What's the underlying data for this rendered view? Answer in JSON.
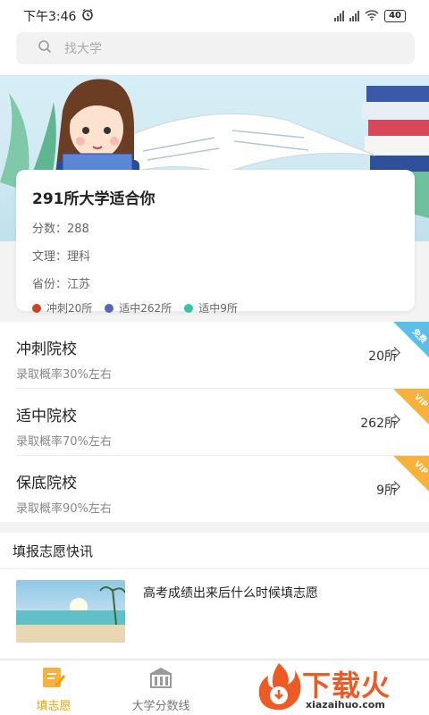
{
  "status_bar": {
    "time": "下午3:46",
    "battery": "40"
  },
  "search": {
    "placeholder": "找大学"
  },
  "result": {
    "title": "291所大学适合你",
    "score": "分数：288",
    "subject": "文理：理科",
    "province": "省份：江苏",
    "legend": [
      {
        "label": "冲刺20所",
        "color": "#c9432a"
      },
      {
        "label": "适中262所",
        "color": "#5b65b5"
      },
      {
        "label": "适中9所",
        "color": "#37c3a8"
      }
    ]
  },
  "categories": [
    {
      "name": "冲刺院校",
      "probability": "录取概率30%左右",
      "count": "20所",
      "badge": "免费",
      "badge_color": "#5bc0e8"
    },
    {
      "name": "适中院校",
      "probability": "录取概率70%左右",
      "count": "262所",
      "badge": "VIP",
      "badge_color": "#f6b23a"
    },
    {
      "name": "保底院校",
      "probability": "录取概率90%左右",
      "count": "9所",
      "badge": "VIP",
      "badge_color": "#f6b23a"
    }
  ],
  "news": {
    "heading": "填报志愿快讯",
    "items": [
      {
        "title": "高考成绩出来后什么时候填志愿"
      }
    ]
  },
  "tabbar": {
    "tabs": [
      {
        "label": "填志愿",
        "active": true
      },
      {
        "label": "大学分数线",
        "active": false
      }
    ]
  },
  "watermark": {
    "brand": "下载火",
    "domain": "xiazaihuo.com"
  }
}
